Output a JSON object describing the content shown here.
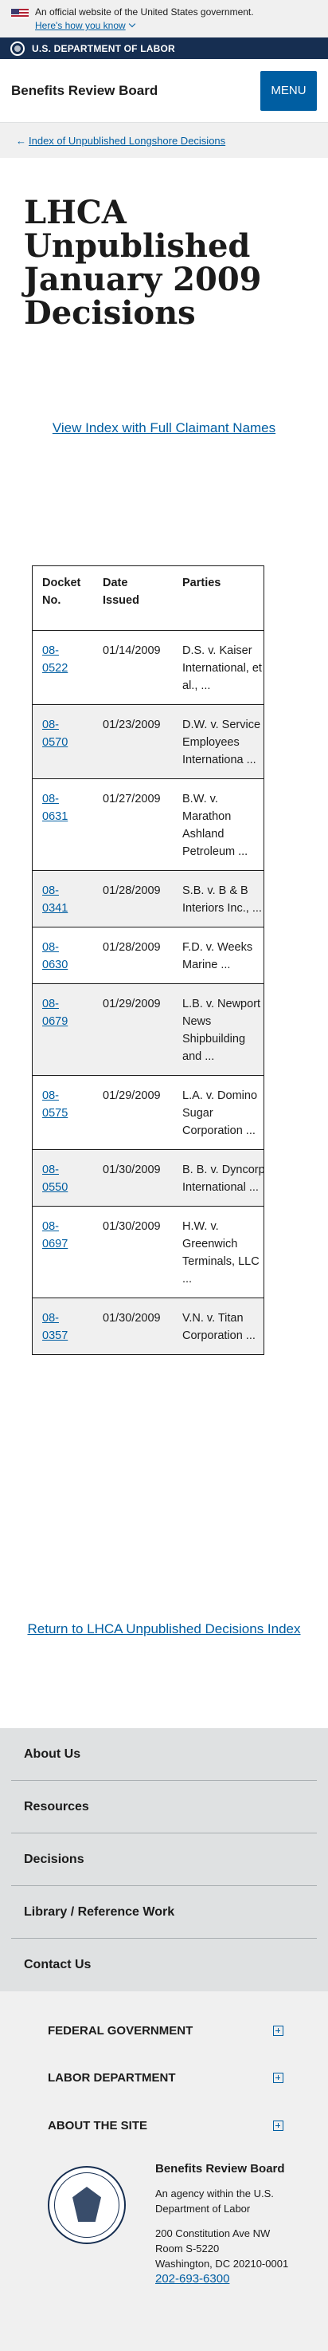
{
  "banner": {
    "official_text": "An official website of the United States government.",
    "how_link": "Here's how you know"
  },
  "agency_strip": {
    "label": "U.S. DEPARTMENT OF LABOR"
  },
  "header": {
    "title": "Benefits Review Board",
    "menu_label": "MENU"
  },
  "breadcrumb": {
    "arrow": "←",
    "label": "Index of Unpublished Longshore Decisions"
  },
  "page": {
    "title": "LHCA Unpublished January 2009 Decisions",
    "index_link": "View Index with Full Claimant Names",
    "return_link": "Return to LHCA Unpublished Decisions Index"
  },
  "table": {
    "headers": [
      "Docket No.",
      "Date Issued",
      "Parties"
    ],
    "rows": [
      {
        "docket": "08-0522",
        "date": "01/14/2009",
        "parties": "D.S. v. Kaiser International, et al., ..."
      },
      {
        "docket": "08-0570",
        "date": "01/23/2009",
        "parties": "D.W. v. Service Employees Internationa ..."
      },
      {
        "docket": "08-0631",
        "date": "01/27/2009",
        "parties": "B.W. v. Marathon Ashland Petroleum ..."
      },
      {
        "docket": "08-0341",
        "date": "01/28/2009",
        "parties": "S.B. v. B & B Interiors Inc., ..."
      },
      {
        "docket": "08-0630",
        "date": "01/28/2009",
        "parties": "F.D. v. Weeks Marine ..."
      },
      {
        "docket": "08-0679",
        "date": "01/29/2009",
        "parties": "L.B. v. Newport News Shipbuilding and ..."
      },
      {
        "docket": "08-0575",
        "date": "01/29/2009",
        "parties": "L.A. v. Domino Sugar Corporation ..."
      },
      {
        "docket": "08-0550",
        "date": "01/30/2009",
        "parties": "B. B. v. Dyncorp International ..."
      },
      {
        "docket": "08-0697",
        "date": "01/30/2009",
        "parties": "H.W. v. Greenwich Terminals, LLC ..."
      },
      {
        "docket": "08-0357",
        "date": "01/30/2009",
        "parties": "V.N. v. Titan Corporation ..."
      }
    ]
  },
  "footer_nav": [
    "About Us",
    "Resources",
    "Decisions",
    "Library / Reference Work",
    "Contact Us"
  ],
  "footer_accordions": [
    "FEDERAL GOVERNMENT",
    "LABOR DEPARTMENT",
    "ABOUT THE SITE"
  ],
  "footer_agency": {
    "name": "Benefits Review Board",
    "description": "An agency within the U.S. Department of Labor",
    "address_line1": "200 Constitution Ave NW",
    "address_line2": "Room S-5220",
    "address_line3": "Washington, DC 20210-0001",
    "phone": "202-693-6300"
  },
  "colors": {
    "link": "#005ea2",
    "navy": "#162e51",
    "stripe": "#f0f0f0"
  }
}
